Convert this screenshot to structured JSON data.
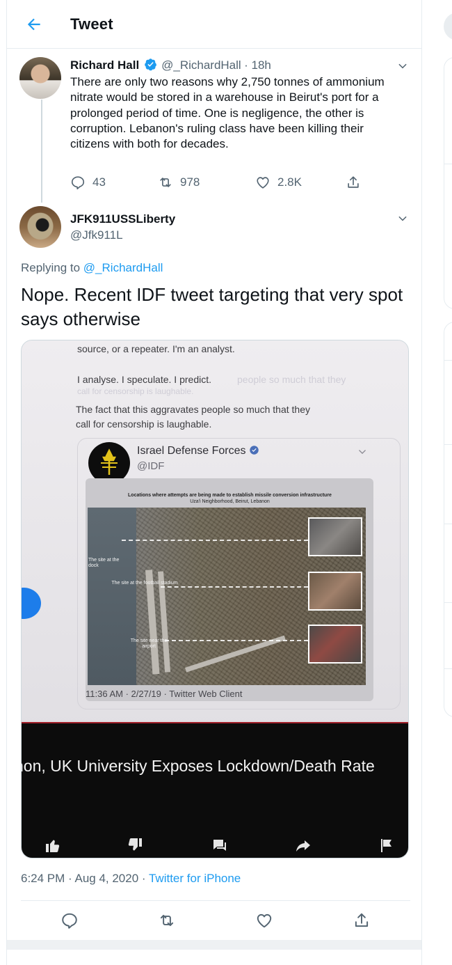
{
  "header": {
    "title": "Tweet"
  },
  "tweet1": {
    "name": "Richard Hall",
    "handle": "@_RichardHall",
    "time": "· 18h",
    "text": "There are only two reasons why 2,750 tonnes of ammonium nitrate would be stored in a warehouse in Beirut's port for a prolonged period of time. One is negligence, the other is corruption. Lebanon's ruling class have been killing their citizens with both for decades.",
    "replies": "43",
    "retweets": "978",
    "likes": "2.8K"
  },
  "tweet2": {
    "name": "JFK911USSLiberty",
    "handle": "@Jfk911L",
    "replying_prefix": "Replying to",
    "replying_to": "@_RichardHall",
    "text": "Nope.  Recent IDF tweet targeting that very spot says otherwise",
    "media": {
      "line1": "source, or a repeater. I'm an analyst.",
      "line2": "I analyse. I speculate. I predict.",
      "line2_ghost": "people so much that they",
      "line3": "The fact that this aggravates people so much that they",
      "line4": "call for censorship is laughable.",
      "ghost_small": "call for censorship is laughable.",
      "idf_name": "Israel Defense Forces",
      "idf_handle": "@IDF",
      "map_title": "Locations where attempts are being made to establish missile conversion infrastructure",
      "map_subtitle": "Uza'i Neighborhood, Beirut, Lebanon",
      "label_dock": "The site at the dock",
      "label_stadium": "The site at the football stadium",
      "label_airport": "The site near the airport",
      "footer": "11:36 AM · 2/27/19 · Twitter Web Client",
      "video_title": "non, UK University Exposes Lockdown/Death Rate"
    },
    "timestamp": "6:24 PM · Aug 4, 2020 ·",
    "source": "Twitter for iPhone"
  }
}
